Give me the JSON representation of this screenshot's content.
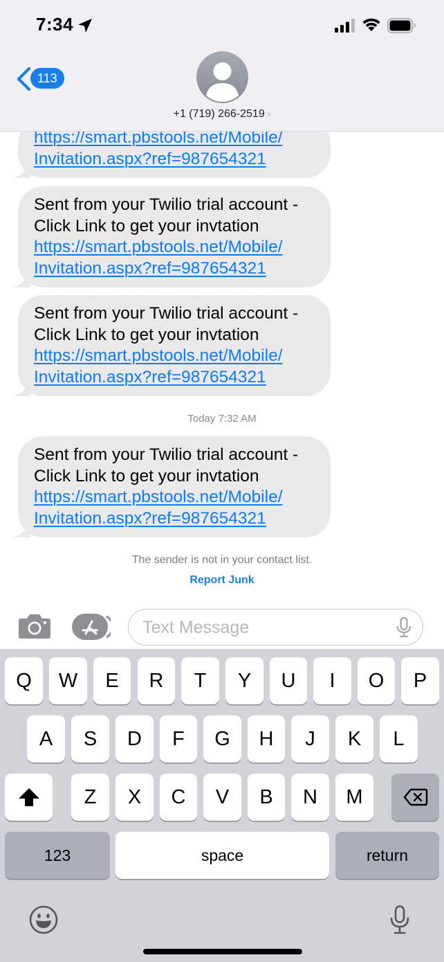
{
  "status_bar": {
    "time": "7:34",
    "icons": [
      "location-arrow-icon",
      "signal-icon",
      "wifi-icon",
      "battery-icon"
    ]
  },
  "header": {
    "back_count": "113",
    "contact": "+1 (719) 266-2519",
    "avatar_icon": "person-silhouette-icon"
  },
  "messages": [
    {
      "lines": [],
      "link_lines": [
        "https://smart.pbstools.net/Mobile/",
        "Invitation.aspx?ref=987654321"
      ]
    },
    {
      "lines": [
        "Sent from your Twilio trial account -",
        "Click Link to get your invtation"
      ],
      "link_lines": [
        "https://smart.pbstools.net/Mobile/",
        "Invitation.aspx?ref=987654321"
      ]
    },
    {
      "lines": [
        "Sent from your Twilio trial account -",
        "Click Link to get your invtation"
      ],
      "link_lines": [
        "https://smart.pbstools.net/Mobile/",
        "Invitation.aspx?ref=987654321"
      ]
    },
    {
      "lines": [
        "Sent from your Twilio trial account -",
        "Click Link to get your invtation"
      ],
      "link_lines": [
        "https://smart.pbstools.net/Mobile/",
        "Invitation.aspx?ref=987654321"
      ]
    }
  ],
  "timestamp": "Today 7:32 AM",
  "sender_note": "The sender is not in your contact list.",
  "report_junk": "Report Junk",
  "input": {
    "placeholder": "Text Message",
    "icons": [
      "camera-icon",
      "app-store-icon",
      "microphone-icon"
    ]
  },
  "keyboard": {
    "row1": [
      "Q",
      "W",
      "E",
      "R",
      "T",
      "Y",
      "U",
      "I",
      "O",
      "P"
    ],
    "row2": [
      "A",
      "S",
      "D",
      "F",
      "G",
      "H",
      "J",
      "K",
      "L"
    ],
    "row3": [
      "Z",
      "X",
      "C",
      "V",
      "B",
      "N",
      "M"
    ],
    "numbers": "123",
    "space": "space",
    "return": "return",
    "icons": [
      "shift-icon",
      "delete-icon",
      "emoji-icon",
      "dictation-mic-icon"
    ]
  },
  "colors": {
    "accent": "#1a7ee8",
    "link": "#0b7bff",
    "bubble": "#e9e9eb",
    "keyboard_bg": "#d1d3d9"
  }
}
